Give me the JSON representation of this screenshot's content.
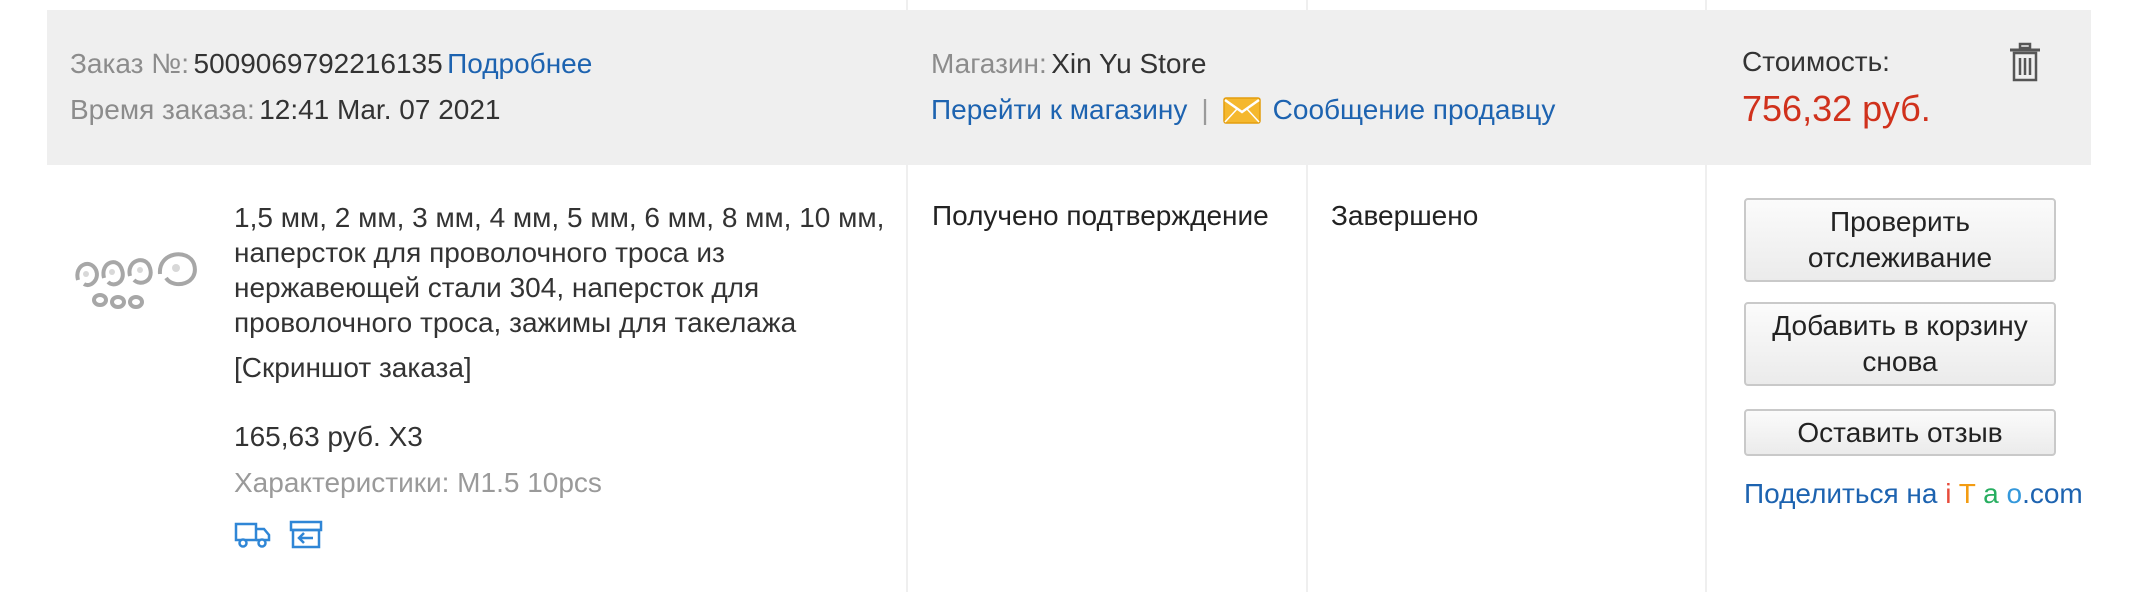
{
  "order": {
    "number_label": "Заказ №:",
    "number_value": "5009069792216135",
    "details_link": "Подробнее",
    "time_label": "Время заказа:",
    "time_value": "12:41 Mar. 07 2021"
  },
  "store": {
    "label": "Магазин:",
    "name": "Xin Yu Store",
    "go_link": "Перейти к магазину",
    "separator": "|",
    "message_link": "Сообщение продавцу",
    "message_icon": "envelope-icon"
  },
  "cost": {
    "label": "Стоимость:",
    "value": "756,32 руб.",
    "delete_icon": "trash-icon"
  },
  "product": {
    "title": "1,5 мм, 2 мм, 3 мм, 4 мм, 5 мм, 6 мм, 8 мм, 10 мм, наперсток для проволочного троса из нержавеющей стали 304, наперсток для проволочного троса, зажимы для такелажа",
    "snapshot": "[Скриншот заказа]",
    "price_qty": "165,63 руб. X3",
    "specs": "Характеристики: M1.5 10pcs",
    "icons": [
      "delivery-truck-icon",
      "return-box-icon"
    ]
  },
  "shipping_status": "Получено подтверждение",
  "order_status": "Завершено",
  "actions": {
    "track": "Проверить отслеживание",
    "add_to_cart": "Добавить в корзину снова",
    "review": "Оставить отзыв"
  },
  "share": {
    "prefix": "Поделиться на",
    "i": "i",
    "t": "T",
    "a": "a",
    "o": "o",
    "suffix": ".com"
  },
  "colors": {
    "link": "#1d63b0",
    "price": "#d0311c",
    "header_bg": "#efefef"
  }
}
